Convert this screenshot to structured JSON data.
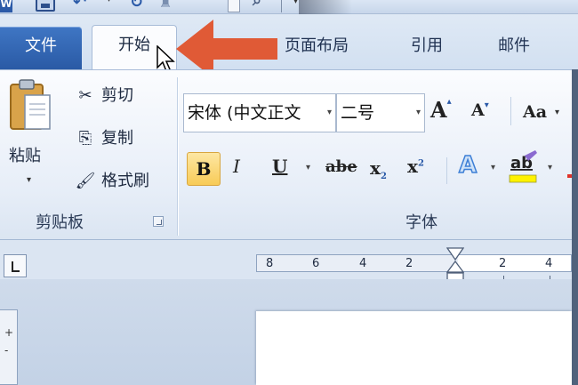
{
  "quick_access": {
    "app_icon_text": "W",
    "undo_icon": "undo-icon",
    "redo_icon": "redo-icon",
    "more_caret": "▾"
  },
  "tabs": {
    "file": "文件",
    "home": "开始",
    "page_layout": "页面布局",
    "references": "引用",
    "mailings": "邮件"
  },
  "clipboard": {
    "group_label": "剪贴板",
    "paste_label": "粘贴",
    "cut_label": "剪切",
    "copy_label": "复制",
    "painter_label": "格式刷"
  },
  "font": {
    "group_label": "字体",
    "font_name_value": "宋体 (中文正文",
    "font_size_value": "二号",
    "grow_label": "A",
    "shrink_label": "A",
    "case_label": "Aa",
    "bold_label": "B",
    "italic_label": "I",
    "underline_label": "U",
    "strike_label": "abe",
    "subscript_label": "x",
    "subscript_mark": "2",
    "superscript_label": "x",
    "superscript_mark": "2",
    "effects_label": "A",
    "highlight_label": "ab"
  },
  "ruler": {
    "ticks": [
      "8",
      "6",
      "4",
      "2",
      "2",
      "4"
    ]
  },
  "vertical_ruler": {
    "marks": [
      "+",
      "-"
    ]
  },
  "colors": {
    "arrow": "#e05a36",
    "file_tab": "#2f63b2",
    "bold_active": "#f8cb57",
    "ribbon_bg": "#eef3fa"
  }
}
